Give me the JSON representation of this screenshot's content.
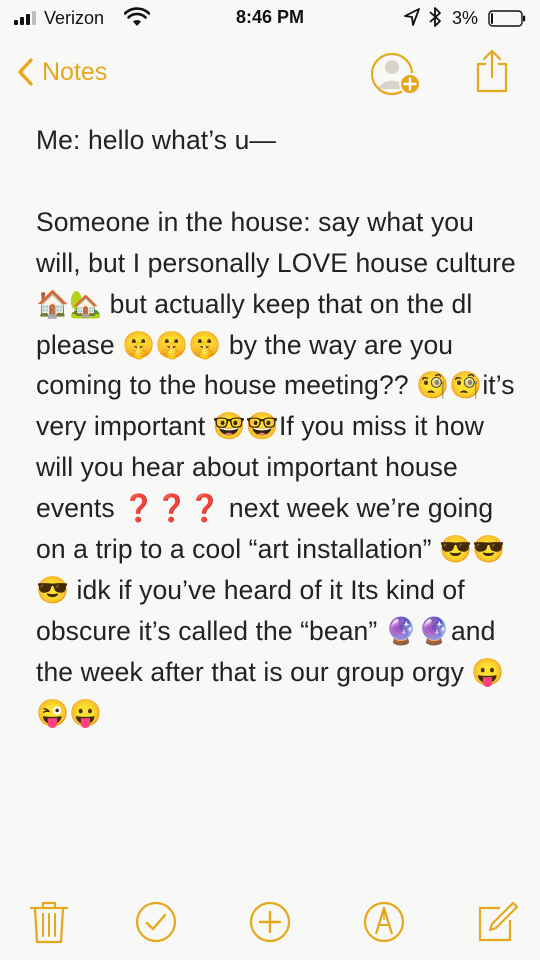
{
  "status_bar": {
    "carrier": "Verizon",
    "time": "8:46 PM",
    "battery_percent": "3%"
  },
  "nav": {
    "back_label": "Notes"
  },
  "note": {
    "text": "Me: hello what’s u—\n\nSomeone in the house: say what you will, but I personally LOVE house culture 🏠🏡 but actually keep that on the dl please 🤫🤫🤫 by the way are you coming to the house meeting?? 🧐🧐it’s very important 🤓🤓If you miss it how will you hear about important house events ❓❓❓ next week we’re going on a trip to a cool “art installation” 😎😎😎 idk if you’ve heard of it Its kind of obscure it’s called the “bean” 🔮🔮and the week after that is our group orgy 😛😜😛"
  },
  "icons": {
    "back": "chevron-left-icon",
    "add_person": "add-person-icon",
    "share": "share-icon",
    "trash": "trash-icon",
    "checklist": "checkmark-circle-icon",
    "add": "plus-circle-icon",
    "sketch": "pen-circle-icon",
    "compose": "compose-icon"
  },
  "colors": {
    "accent": "#E5A71D",
    "background": "#F8F8F6",
    "text": "#222222"
  }
}
